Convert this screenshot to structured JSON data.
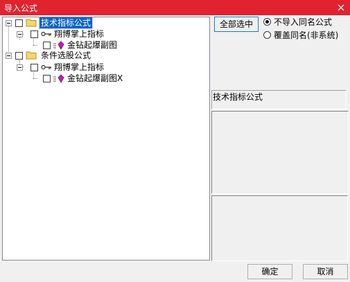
{
  "window": {
    "title": "导入公式"
  },
  "tree": {
    "groups": [
      {
        "label": "技术指标公式",
        "selected": true,
        "children": [
          {
            "label": "翔博掌上指标",
            "children": [
              {
                "label": "金钻起爆副图"
              }
            ]
          }
        ]
      },
      {
        "label": "条件选股公式",
        "selected": false,
        "children": [
          {
            "label": "翔博掌上指标",
            "children": [
              {
                "label": "金钻起爆副图X"
              }
            ]
          }
        ]
      }
    ]
  },
  "controls": {
    "select_all_label": "全部选中",
    "options": [
      {
        "label": "不导入同名公式",
        "checked": true
      },
      {
        "label": "覆盖同名(非系统)",
        "checked": false
      }
    ]
  },
  "details": {
    "formula_type": "技术指标公式"
  },
  "footer": {
    "ok_label": "确定",
    "cancel_label": "取消"
  }
}
